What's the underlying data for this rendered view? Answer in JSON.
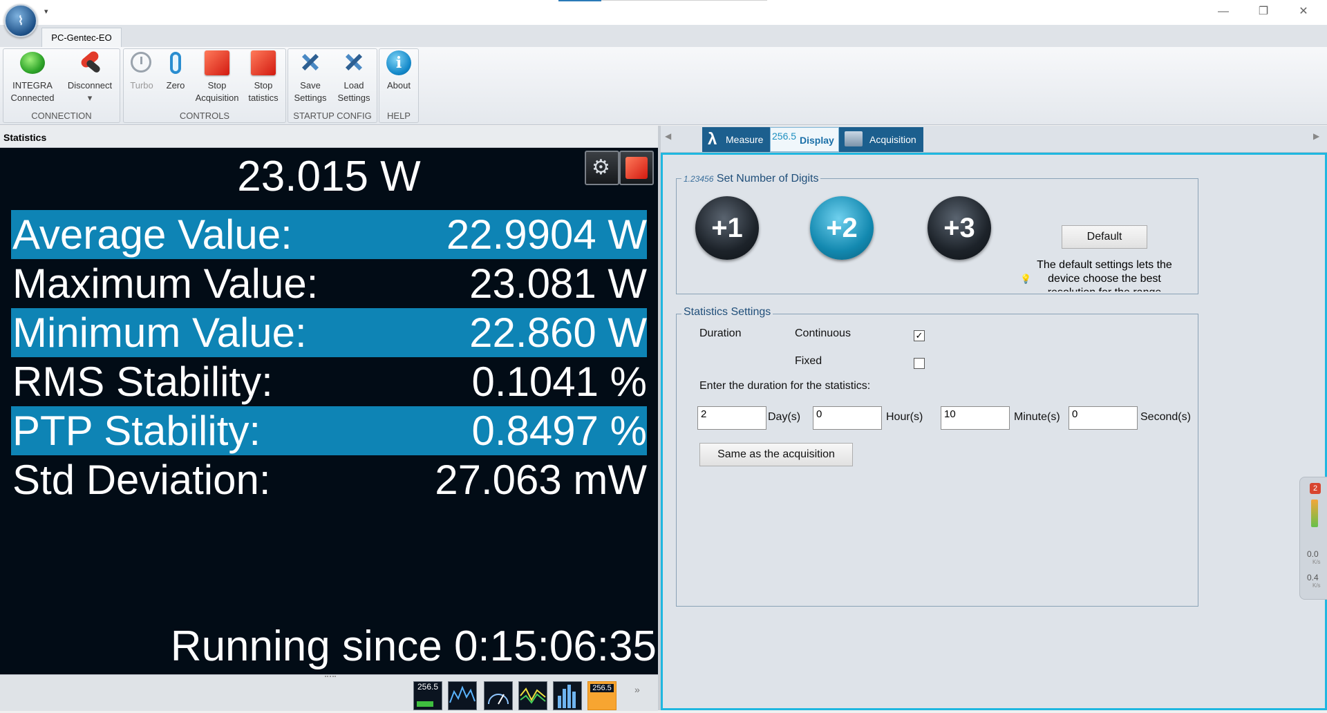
{
  "window": {
    "tab_label": "PC-Gentec-EO",
    "minimize": "—",
    "restore": "❐",
    "close": "✕"
  },
  "ribbon": {
    "groups": [
      {
        "label": "CONNECTION",
        "buttons": [
          {
            "line1": "INTEGRA",
            "line2": "Connected",
            "icon": "green-status-orb-icon"
          },
          {
            "line1": "Disconnect",
            "line2": "▾",
            "icon": "disconnect-plug-icon"
          }
        ]
      },
      {
        "label": "CONTROLS",
        "buttons": [
          {
            "line1": "Turbo",
            "line2": "",
            "icon": "turbo-clock-icon",
            "disabled": true
          },
          {
            "line1": "Zero",
            "line2": "",
            "icon": "zero-icon"
          },
          {
            "line1": "Stop",
            "line2": "Acquisition",
            "icon": "stop-square-icon"
          },
          {
            "line1": "Stop",
            "line2": "tatistics",
            "icon": "stop-square-icon"
          }
        ]
      },
      {
        "label": "STARTUP CONFIG",
        "buttons": [
          {
            "line1": "Save",
            "line2": "Settings",
            "icon": "save-settings-icon"
          },
          {
            "line1": "Load",
            "line2": "Settings",
            "icon": "load-settings-icon"
          }
        ]
      },
      {
        "label": "HELP",
        "buttons": [
          {
            "line1": "About",
            "line2": "",
            "icon": "info-icon"
          }
        ]
      }
    ]
  },
  "stats": {
    "header": "Statistics",
    "current_reading": "23.015 W",
    "rows": [
      {
        "label": "Average Value:",
        "value": "22.9904 W",
        "highlight": true
      },
      {
        "label": "Maximum Value:",
        "value": "23.081 W",
        "highlight": false
      },
      {
        "label": "Minimum Value:",
        "value": "22.860 W",
        "highlight": true
      },
      {
        "label": "RMS Stability:",
        "value": "0.1041 %",
        "highlight": false
      },
      {
        "label": "PTP Stability:",
        "value": "0.8497 %",
        "highlight": true
      },
      {
        "label": "Std Deviation:",
        "value": "27.063 mW",
        "highlight": false
      }
    ],
    "running_since": "Running since 0:15:06:35",
    "highlight_color": "#0e84b5"
  },
  "bottom_thumbs": [
    {
      "name": "display-view-thumb",
      "text": "256.5"
    },
    {
      "name": "realtime-graph-thumb",
      "text": ""
    },
    {
      "name": "needle-gauge-thumb",
      "text": ""
    },
    {
      "name": "tuning-graph-thumb",
      "text": ""
    },
    {
      "name": "histogram-thumb",
      "text": ""
    },
    {
      "name": "statistics-view-thumb",
      "text": "256.5"
    }
  ],
  "right_tabs": {
    "measure": "Measure",
    "display": "Display",
    "display_badge": "256.5",
    "acquisition": "Acquisition"
  },
  "display": {
    "digits_group_icon": "1.23456",
    "digits_group_title": "Set Number of Digits",
    "digit_buttons": [
      "+1",
      "+2",
      "+3"
    ],
    "default_button": "Default",
    "default_hint": "The default settings lets the device choose the best resolution for the range",
    "stats_group_title": "Statistics Settings",
    "duration_label": "Duration",
    "continuous_label": "Continuous",
    "continuous_checked": true,
    "fixed_label": "Fixed",
    "fixed_checked": false,
    "enter_duration_label": "Enter the duration for the statistics:",
    "days_value": "2",
    "days_label": "Day(s)",
    "hours_value": "0",
    "hours_label": "Hour(s)",
    "minutes_value": "10",
    "minutes_label": "Minute(s)",
    "seconds_value": "0",
    "seconds_label": "Second(s)",
    "same_as_acq_button": "Same as the acquisition"
  },
  "net_widget": {
    "badge": "2",
    "up_value": "0.0",
    "up_unit": "K/s",
    "down_value": "0.4",
    "down_unit": "K/s"
  }
}
